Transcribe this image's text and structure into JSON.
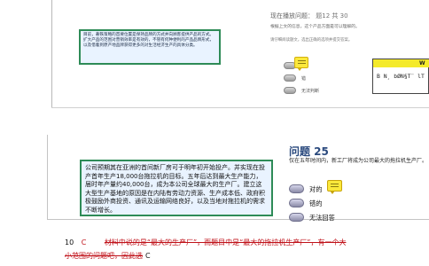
{
  "top_panel": {
    "passage": "目前，著铁策略的首要位置是保持品牌的方式并向顾客提供产品的方式。扩大产品的范围对营销效率是有效的，不管有何种便利的产品品牌形式，以及借着到原产地品牌获得更多的对生活经济生产的具体分类。",
    "progress_label": "现在播放问题：",
    "progress_current": "题12",
    "progress_of": "共",
    "progress_total": "30",
    "question_text": "根据上文的信息，这个产品方面是可以理解的。",
    "hint_text": "请仔细阅读题文，选出正确的选项并提交答案。",
    "options": [
      {
        "label": "对"
      },
      {
        "label": "错"
      },
      {
        "label": "无法判断"
      }
    ],
    "overlay_header": "W",
    "overlay_text": "B  N¸ bØN§T¨ lT"
  },
  "bottom_panel": {
    "question_title": "问题 25",
    "question_text": "仅在五年时间内，新工厂将成为公司最大的拖拉机生产厂。",
    "passage": "公司预期其在亚洲的首间新厂房可于明年初开始投产。并实现在投产首年生产18,000台拖拉机的目标。五年后达到最大生产能力，届时年产量约40,000台，成为本公司全球最大的生产厂。建立这大型生产基地的原因是在内陆有劳动力资源、生产成本低、政府积极鼓励外商投资、通讯及运输网络良好，以及当地对拖拉机的需求不断增长。",
    "options": [
      {
        "label": "对的"
      },
      {
        "label": "错的"
      },
      {
        "label": "无法回答"
      }
    ]
  },
  "answer_note": {
    "number": "10",
    "letter": "C",
    "explanation_line1": "材料中说的是“最大的生产厂”，而题目中是“最大的拖拉机生产厂”，有一个大",
    "explanation_line2": "小范围的问题吧，因此选",
    "final_letter": "C"
  },
  "colors": {
    "passage_border": "#2e8b57",
    "passage_bg": "#e9f3ff",
    "title_blue": "#2b4a7e",
    "answer_red": "#c0121a",
    "note_yellow": "#fbe83b"
  }
}
